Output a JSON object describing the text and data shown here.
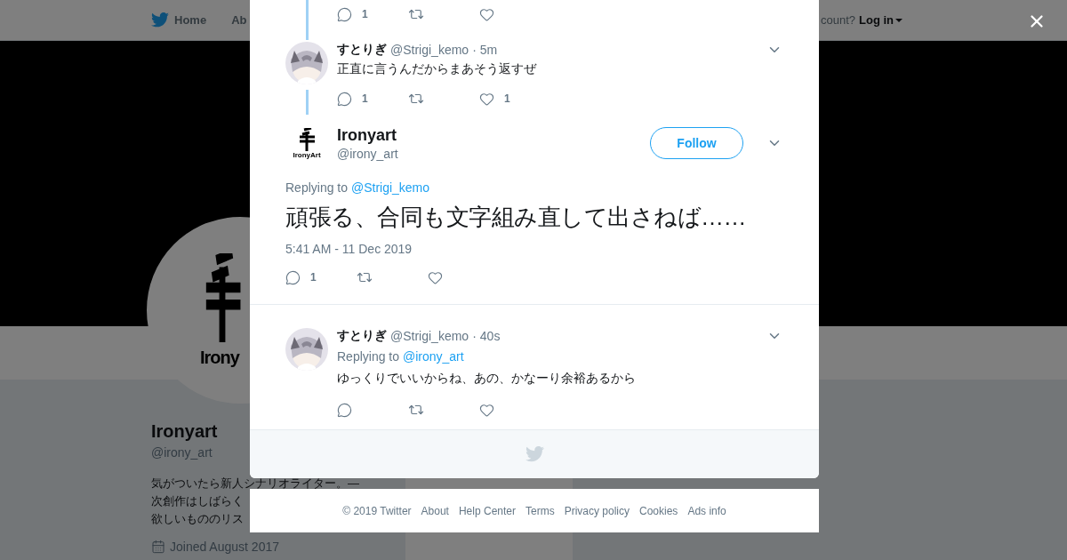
{
  "nav": {
    "items": [
      {
        "label": "Home",
        "kind": "home"
      },
      {
        "label": "Ab",
        "kind": "plain"
      }
    ],
    "account_prompt": "count?",
    "login": "Log in"
  },
  "profile": {
    "avatar_text": "Irony",
    "name": "Ironyart",
    "handle": "@irony_art",
    "bio": [
      "気がついたら新人シナリオライター。—",
      "次創作はしばらく",
      "欲しいもののリス"
    ],
    "joined": "Joined August 2017"
  },
  "thread_top": {
    "actions": {
      "replies": "1"
    }
  },
  "tweets": [
    {
      "kind": "reply",
      "name": "すとりぎ",
      "handle": "@Strigi_kemo",
      "separator": "·",
      "time": "5m",
      "text": "正直に言うんだからまあそう返すぜ",
      "actions": {
        "replies": "1",
        "likes": "1"
      },
      "thread_below": true
    },
    {
      "kind": "main",
      "name": "Ironyart",
      "handle": "@irony_art",
      "avatar_text": "IronyArt",
      "follow": "Follow",
      "replying_label": "Replying to",
      "replying_to": "@Strigi_kemo",
      "text": "頑張る、合同も文字組み直して出さねば……",
      "timestamp": "5:41 AM - 11 Dec 2019",
      "actions": {
        "replies": "1"
      }
    },
    {
      "kind": "reply",
      "name": "すとりぎ",
      "handle": "@Strigi_kemo",
      "separator": "·",
      "time": "40s",
      "replying_label": "Replying to",
      "replying_to": "@irony_art",
      "text": "ゆっくりでいいからね、あの、かなーり余裕あるから",
      "thread_below": false
    }
  ],
  "footer": [
    "© 2019 Twitter",
    "About",
    "Help Center",
    "Terms",
    "Privacy policy",
    "Cookies",
    "Ads info"
  ]
}
